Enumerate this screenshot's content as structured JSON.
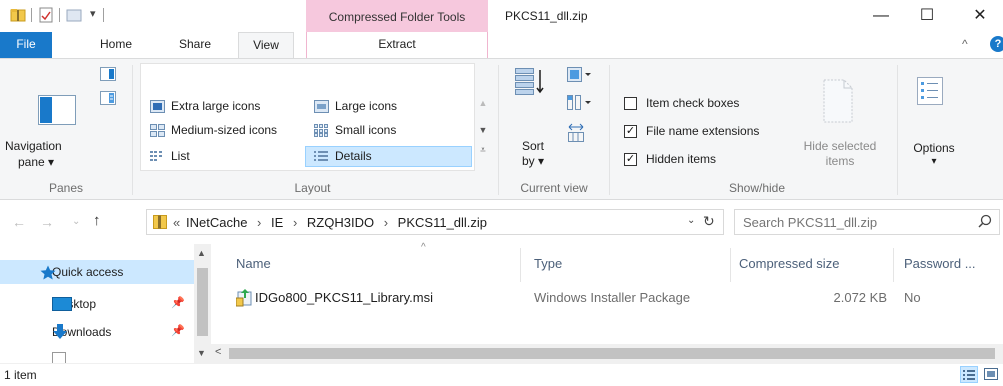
{
  "window": {
    "title": "PKCS11_dll.zip",
    "context_tab": "Compressed Folder Tools",
    "controls": {
      "minimize": "—",
      "maximize": "☐",
      "close": "✕"
    }
  },
  "tabs": {
    "file": "File",
    "home": "Home",
    "share": "Share",
    "view": "View",
    "extract": "Extract",
    "collapse": "^",
    "help": "?"
  },
  "ribbon": {
    "panes": {
      "nav_label_1": "Navigation",
      "nav_label_2": "pane ▾",
      "group": "Panes"
    },
    "layout": {
      "extra_large": "Extra large icons",
      "large": "Large icons",
      "medium": "Medium-sized icons",
      "small": "Small icons",
      "list": "List",
      "details": "Details",
      "group": "Layout"
    },
    "current_view": {
      "sort_1": "Sort",
      "sort_2": "by ▾",
      "group": "Current view"
    },
    "show_hide": {
      "item_check_boxes": "Item check boxes",
      "item_check_boxes_checked": false,
      "file_name_extensions": "File name extensions",
      "file_name_extensions_checked": true,
      "hidden_items": "Hidden items",
      "hidden_items_checked": true,
      "hide_selected_1": "Hide selected",
      "hide_selected_2": "items",
      "group": "Show/hide"
    },
    "options": {
      "label": "Options",
      "arrow": "▾"
    }
  },
  "address": {
    "overflow": "«",
    "crumbs": [
      "INetCache",
      "IE",
      "RZQH3IDO",
      "PKCS11_dll.zip"
    ],
    "separator": "›",
    "search_placeholder": "Search PKCS11_dll.zip"
  },
  "nav_pane": {
    "items": [
      {
        "label": "Quick access"
      },
      {
        "label": "Desktop"
      },
      {
        "label": "Downloads"
      }
    ]
  },
  "file_list": {
    "columns": [
      "Name",
      "Type",
      "Compressed size",
      "Password ..."
    ],
    "rows": [
      {
        "name": "IDGo800_PKCS11_Library.msi",
        "type": "Windows Installer Package",
        "size": "2.072 KB",
        "password": "No"
      }
    ]
  },
  "status": {
    "count": "1 item"
  },
  "colors": {
    "accent": "#1979ca",
    "context": "#f6c8dd",
    "selection": "#cce8ff"
  }
}
